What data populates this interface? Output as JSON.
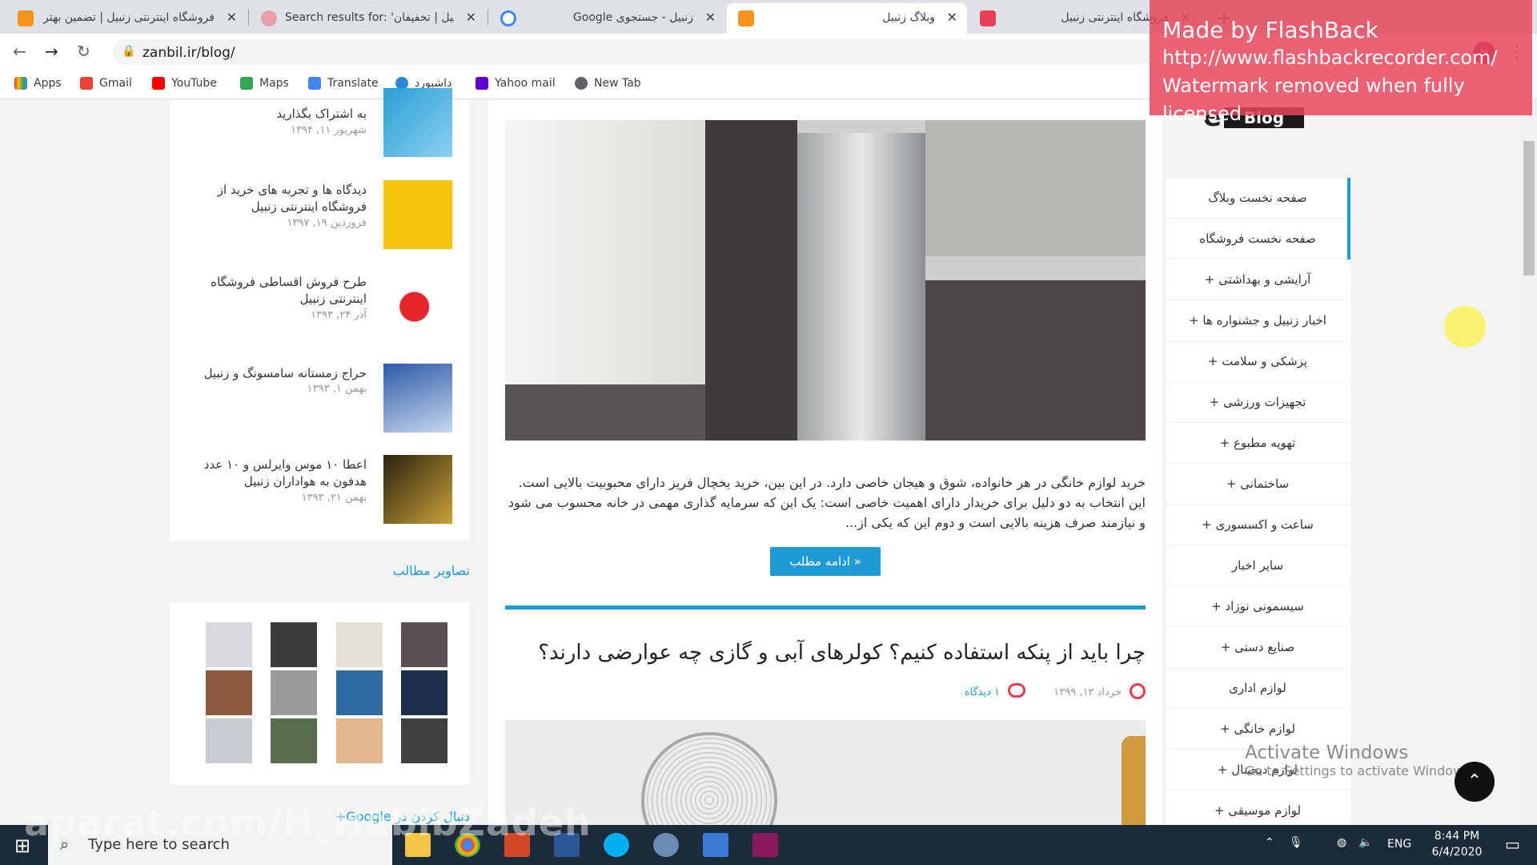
{
  "browser": {
    "tabs": [
      {
        "title": "فروشگاه اینترنتی زنبیل | تضمین بهتر",
        "icon": "zanbil-icon"
      },
      {
        "title": "Search results for: 'زنبیل | تخفیفان'",
        "icon": "search-results-icon"
      },
      {
        "title": "زنبیل - جستجوی Google",
        "icon": "google-icon"
      },
      {
        "title": "وبلاگ زنبیل",
        "icon": "zanbil-icon"
      },
      {
        "title": "فروشگاه اینترنتی زنبیل",
        "icon": "zanbil-alt-icon"
      }
    ],
    "new_tab": "+",
    "url": "zanbil.ir/blog/",
    "bookmarks": [
      "Apps",
      "Gmail",
      "YouTube",
      "Maps",
      "Translate",
      "داشبورد",
      "Yahoo mail",
      "New Tab"
    ],
    "profile_initial": "H"
  },
  "blog": {
    "logo_text": "Blog",
    "logo_e": "e",
    "recent_posts": [
      {
        "title": "به اشتراک بگذارید",
        "date": "شهریور ۱۱, ۱۳۹۴"
      },
      {
        "title": "دیدگاه ها و تجربه های خرید از فروشگاه اینترنتی زنبیل",
        "date": "فروردین ۱۹, ۱۳۹۷"
      },
      {
        "title": "طرح فروش اقساطی فروشگاه اینترنتی زنبیل",
        "date": "آذر ۲۴, ۱۳۹۳"
      },
      {
        "title": "حراج زمستانه سامسونگ و زنبیل",
        "date": "بهمن ۱, ۱۳۹۳"
      },
      {
        "title": "اعطا ۱۰ موس وایرلس و ۱۰ عدد هدفون به هواداران زنبیل",
        "date": "بهمن ۲۱, ۱۳۹۳"
      }
    ],
    "gallery_title": "تصاویر مطالب",
    "google_follow": "دنبال کردن در Google+",
    "excerpt": "خرید لوازم خانگی در هر خانواده، شوق و هیجان خاصی دارد. در این بین، خرید یخچال فریز دارای محبوبیت بالایی است. این انتخاب به دو دلیل برای خریدار دارای اهمیت خاصی است: یک این که سرمایه گذاری مهمی در خانه محسوب می شود و نیازمند صرف هزینه بالایی است و دوم این که یکی از...",
    "read_more": "ادامه مطلب »",
    "post_title": "چرا باید از پنکه استفاده کنیم؟ کولرهای آبی و گازی چه عوارضی دارند؟",
    "post_date": "خرداد ۱۲, ۱۳۹۹",
    "post_comments": "۱ دیدگاه",
    "menu": [
      "صفحه نخست وبلاگ",
      "صفحه نخست فروشگاه",
      "آرایشی و بهداشتی +",
      "اخبار زنبیل و جشنواره ها +",
      "پزشکی و سلامت +",
      "تجهیزات ورزشی +",
      "تهویه مطبوع +",
      "ساختمانی +",
      "ساعت و اکسسوری +",
      "سایر اخبار",
      "سیسمونی نوزاد +",
      "صنایع دستی +",
      "لوازم اداری",
      "لوازم خانگی +",
      "لوازم دیجیتال +",
      "لوازم موسیقی +"
    ]
  },
  "overlay": {
    "watermark_line1": "Made by FlashBack",
    "watermark_line2": "http://www.flashbackrecorder.com/",
    "watermark_line3": "Watermark removed when fully licensed",
    "activate_title": "Activate Windows",
    "activate_sub": "Go to Settings to activate Windows.",
    "aparat": "aparat.com/H_HabibZadeh"
  },
  "taskbar": {
    "search_placeholder": "Type here to search",
    "lang": "ENG",
    "time": "8:44 PM",
    "date": "6/4/2020"
  },
  "colors": {
    "accent": "#1e9ad6",
    "watermark": "#e6465a",
    "taskbar": "#1c2b3a"
  }
}
